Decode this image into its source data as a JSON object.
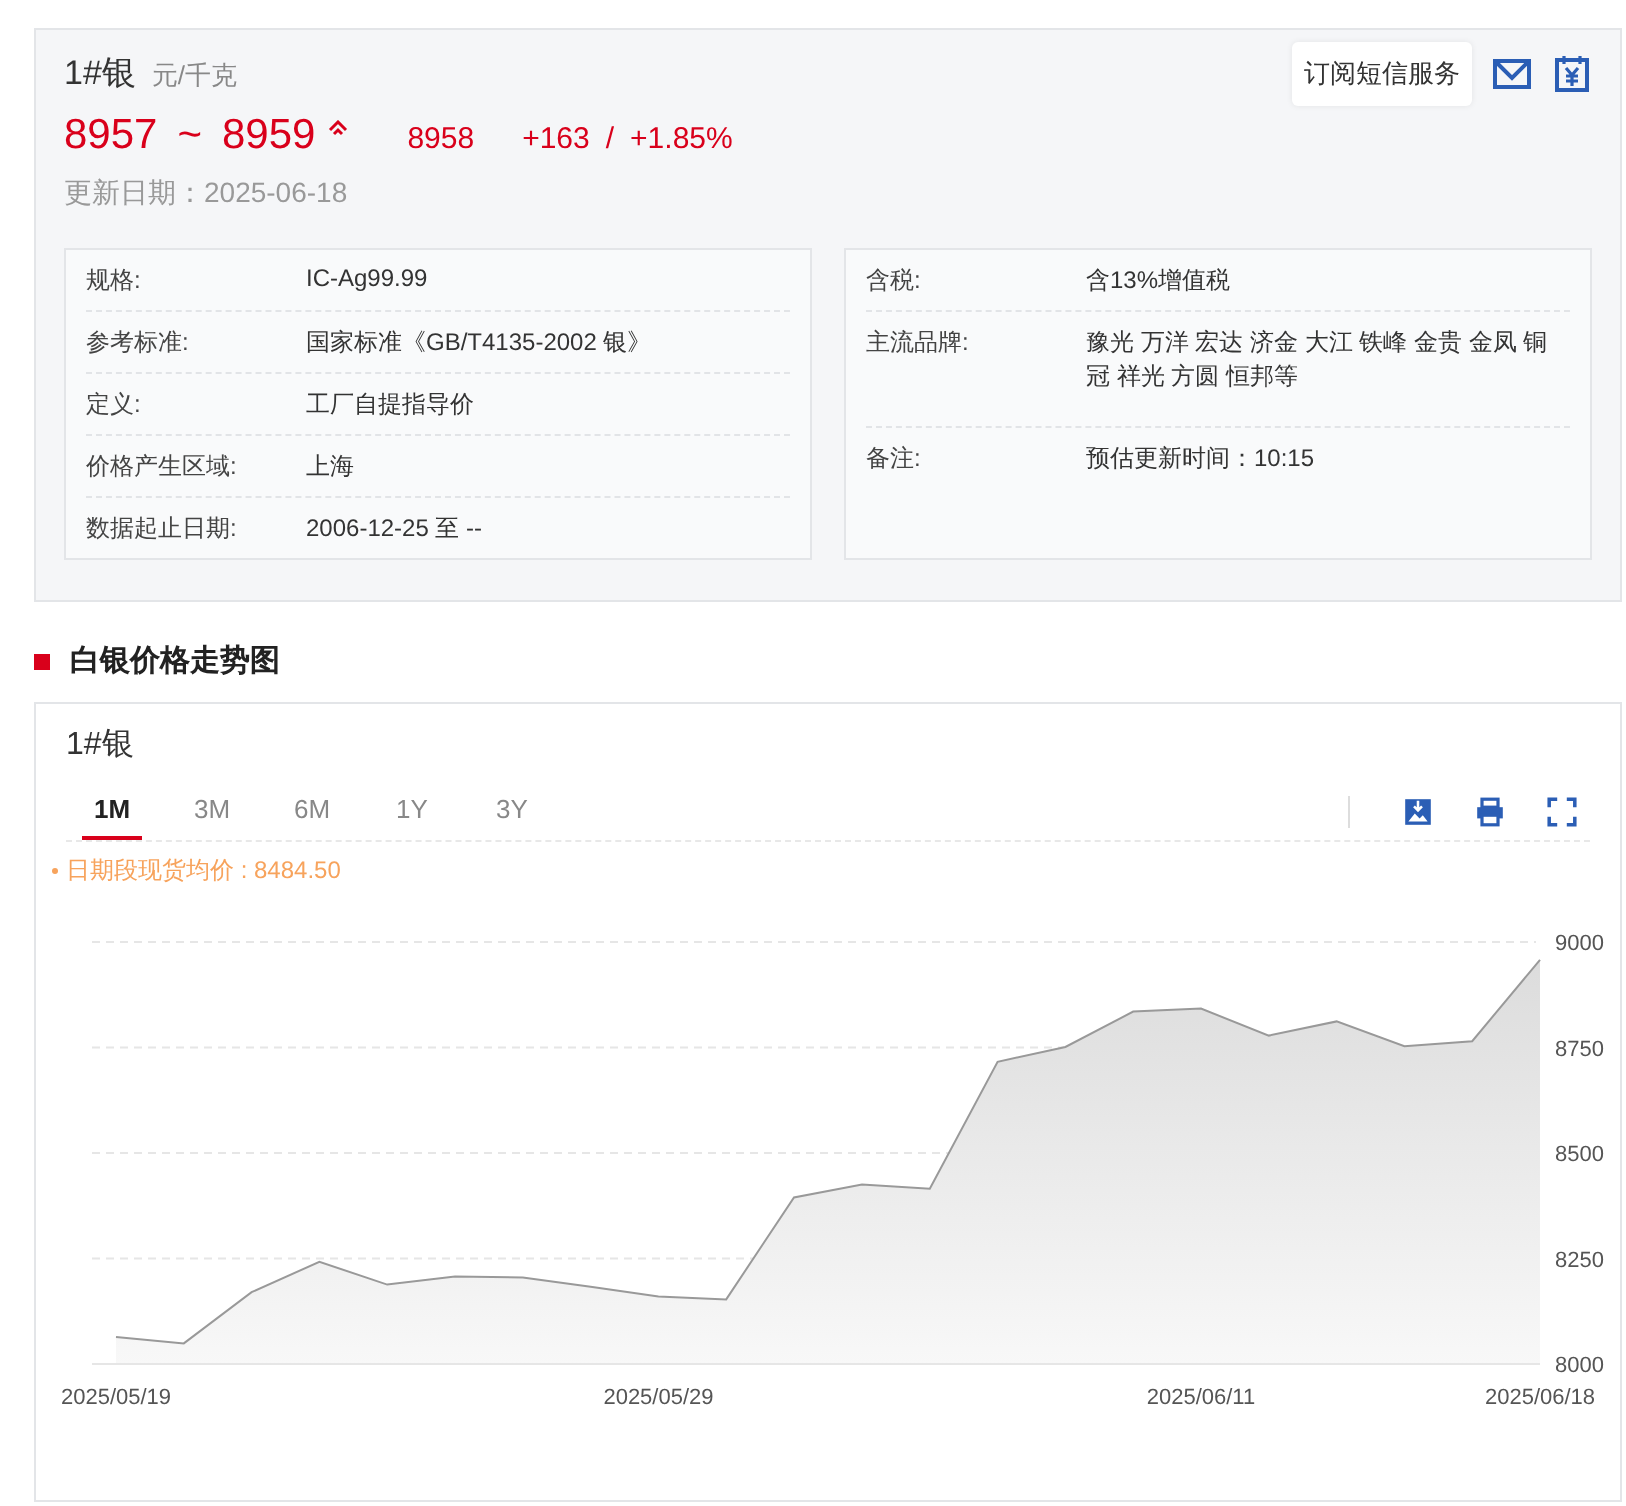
{
  "price_card": {
    "product": "1#银",
    "unit": "元/千克",
    "price_low": "8957",
    "separator": "~",
    "price_high": "8959",
    "average": "8958",
    "change": "+163",
    "slash": "/",
    "change_pct": "+1.85%",
    "updated": "更新日期：2025-06-18",
    "subscribe_button": "订阅短信服务",
    "info_left": [
      {
        "label": "规格:",
        "value": "IC-Ag99.99"
      },
      {
        "label": "参考标准:",
        "value": "国家标准《GB/T4135-2002 银》"
      },
      {
        "label": "定义:",
        "value": "工厂自提指导价"
      },
      {
        "label": "价格产生区域:",
        "value": "上海"
      },
      {
        "label": "数据起止日期:",
        "value": "2006-12-25 至 --"
      }
    ],
    "info_right": [
      {
        "label": "含税:",
        "value": "含13%增值税"
      },
      {
        "label": "主流品牌:",
        "value": "豫光 万洋 宏达 济金 大江 铁峰 金贵 金凤 铜冠 祥光 方圆 恒邦等"
      },
      {
        "label": "备注:",
        "value": "预估更新时间：10:15"
      }
    ]
  },
  "trend_section": {
    "heading": "白银价格走势图",
    "title": "1#银",
    "tabs": [
      {
        "label": "1M",
        "selected": true
      },
      {
        "label": "3M",
        "selected": false
      },
      {
        "label": "6M",
        "selected": false
      },
      {
        "label": "1Y",
        "selected": false
      },
      {
        "label": "3Y",
        "selected": false
      }
    ],
    "average_note": "日期段现货均价 : 8484.50",
    "chart_data": {
      "type": "area",
      "categories": [
        "2025/05/19",
        null,
        null,
        null,
        null,
        null,
        null,
        null,
        "2025/05/29",
        null,
        null,
        null,
        null,
        null,
        null,
        null,
        "2025/06/11",
        null,
        null,
        null,
        null,
        "2025/06/18"
      ],
      "series": [
        {
          "color": "#999999",
          "values": [
            8064,
            8049,
            8170,
            8242,
            8188,
            8207,
            8205,
            8183,
            8160,
            8153,
            8395,
            8425,
            8415,
            8716,
            8751,
            8835,
            8842,
            8778,
            8812,
            8753,
            8765,
            8958
          ]
        }
      ],
      "ylim": [
        8000,
        9000
      ],
      "grid": true,
      "yticks": [
        8000,
        8250,
        8500,
        8750,
        9000
      ]
    }
  }
}
